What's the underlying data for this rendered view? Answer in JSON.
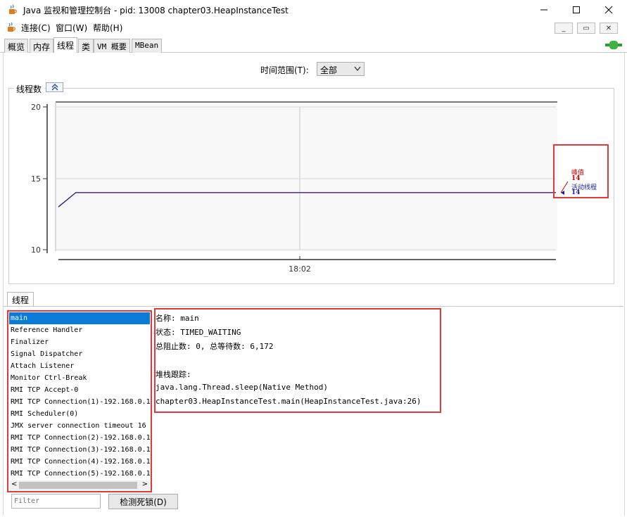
{
  "window": {
    "title": "Java 监视和管理控制台 - pid: 13008 chapter03.HeapInstanceTest"
  },
  "menu": {
    "items": [
      "连接(C)",
      "窗口(W)",
      "帮助(H)"
    ]
  },
  "tabs": [
    {
      "label": "概览",
      "active": false
    },
    {
      "label": "内存",
      "active": false
    },
    {
      "label": "线程",
      "active": true
    },
    {
      "label": "类",
      "active": false
    },
    {
      "label": "VM 概要",
      "active": false
    },
    {
      "label": "MBean",
      "active": false
    }
  ],
  "time_range": {
    "label": "时间范围(T):",
    "selected": "全部"
  },
  "chart_panel": {
    "title": "线程数"
  },
  "chart_data": {
    "type": "line",
    "title": "线程数",
    "ylim": [
      10,
      20
    ],
    "yticks": [
      "20",
      "15",
      "10"
    ],
    "xtick": "18:02",
    "series": [
      {
        "name": "峰值",
        "color": "#d00000",
        "x": [
          0,
          0.035,
          1
        ],
        "values": [
          13,
          14,
          14
        ],
        "latest": "14"
      },
      {
        "name": "活动线程",
        "color": "#1c1c9a",
        "x": [
          0,
          0.035,
          1
        ],
        "values": [
          13,
          14,
          14
        ],
        "latest": "14"
      }
    ],
    "grid": true,
    "legend": "right"
  },
  "threads_panel": {
    "tab_label": "线程",
    "threads": [
      "main",
      "Reference Handler",
      "Finalizer",
      "Signal Dispatcher",
      "Attach Listener",
      "Monitor Ctrl-Break",
      "RMI TCP Accept-0",
      "RMI TCP Connection(1)-192.168.0.1",
      "RMI Scheduler(0)",
      "JMX server connection timeout 16",
      "RMI TCP Connection(2)-192.168.0.1",
      "RMI TCP Connection(3)-192.168.0.1",
      "RMI TCP Connection(4)-192.168.0.1",
      "RMI TCP Connection(5)-192.168.0.1"
    ],
    "selected_index": 0,
    "filter_placeholder": "Filter",
    "detect_deadlock_label": "检测死锁(D)"
  },
  "thread_detail": {
    "lines": [
      "名称: main",
      "状态: TIMED_WAITING",
      "总阻止数: 0, 总等待数: 6,172",
      "",
      "堆栈跟踪:",
      "java.lang.Thread.sleep(Native Method)",
      "chapter03.HeapInstanceTest.main(HeapInstanceTest.java:26)"
    ]
  },
  "colors": {
    "highlight_border": "#e23a3a",
    "selection": "#0a7bd7",
    "live_line": "#1c1c9a",
    "peak": "#d00000"
  }
}
